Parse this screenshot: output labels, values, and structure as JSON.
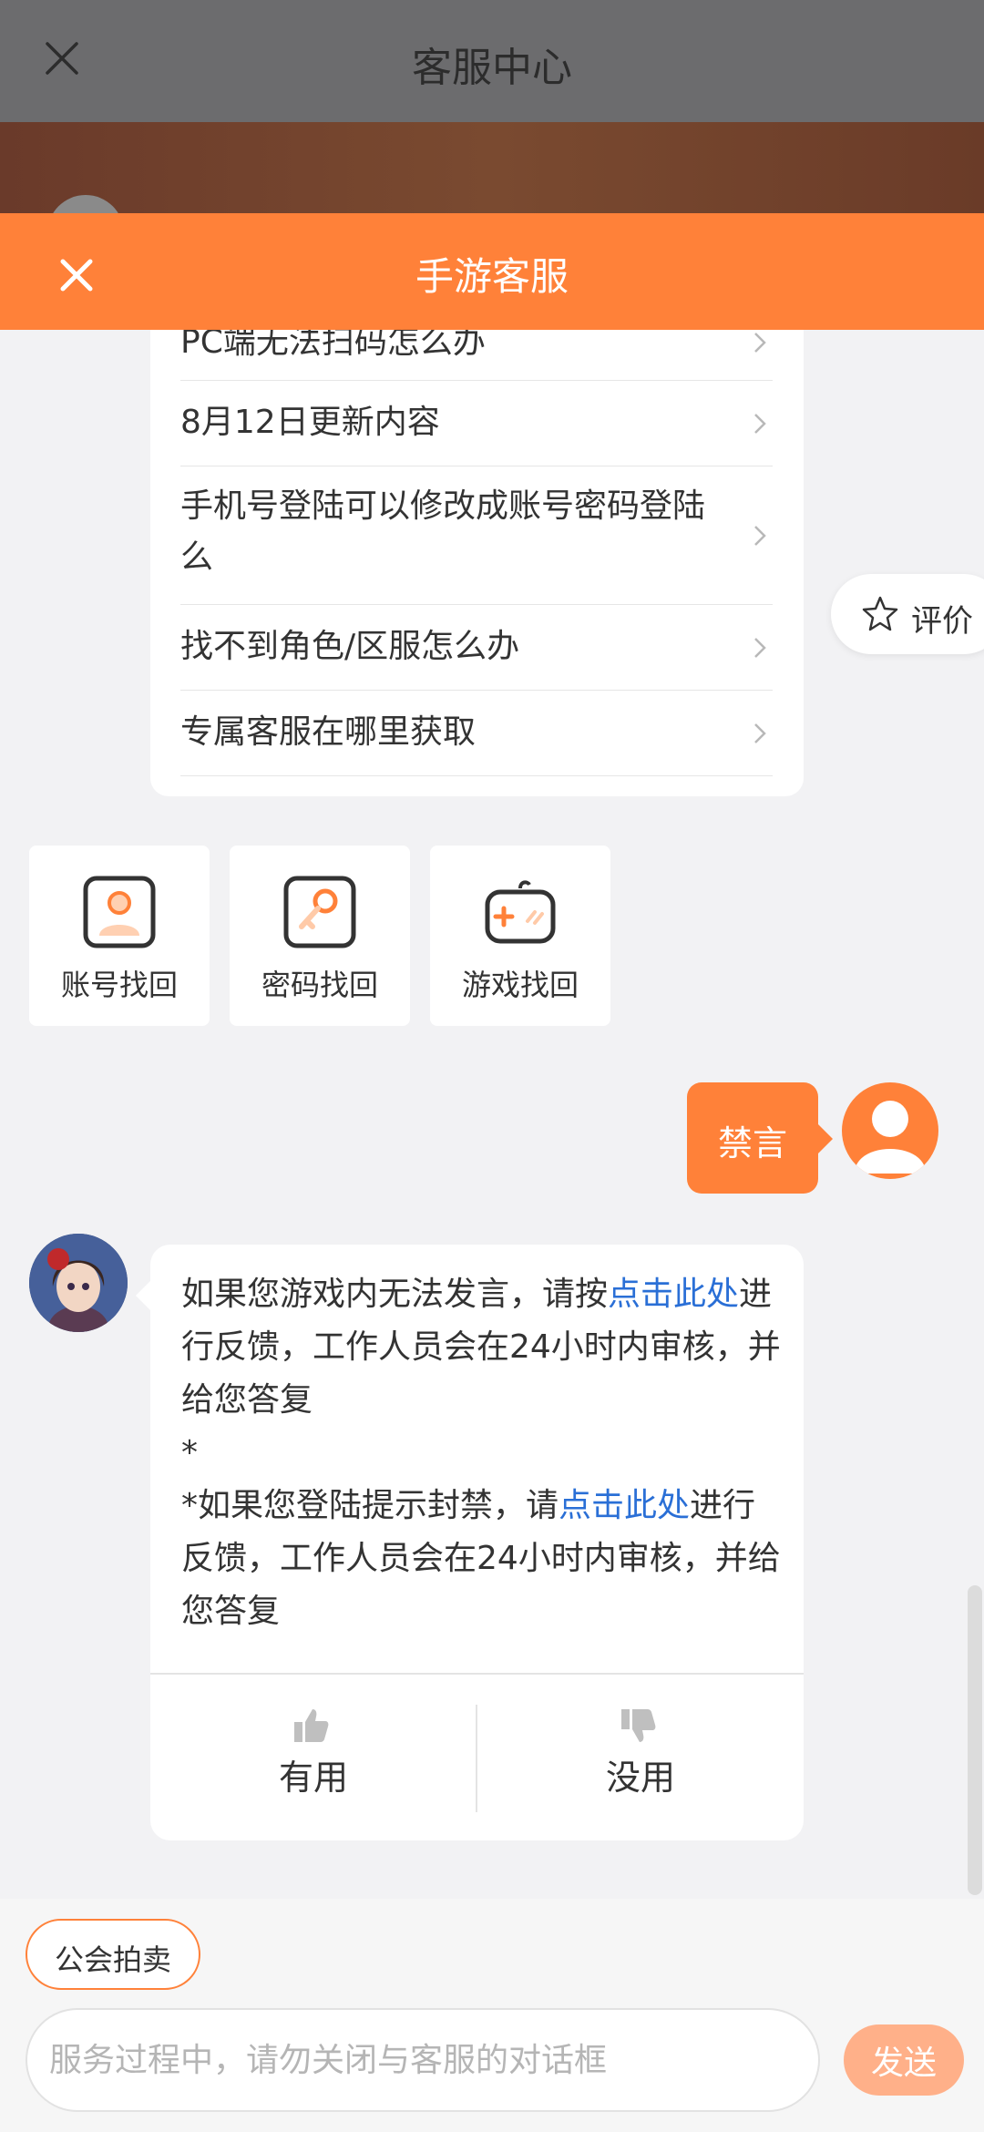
{
  "top_header": {
    "title": "客服中心"
  },
  "nav_bar": {
    "title": "手游客服",
    "bg_color": "#ff8139"
  },
  "faq": {
    "items": [
      {
        "label": "PC端无法扫码怎么办"
      },
      {
        "label": "8月12日更新内容"
      },
      {
        "label": "手机号登陆可以修改成账号密码登陆么"
      },
      {
        "label": "找不到角色/区服怎么办"
      },
      {
        "label": "专属客服在哪里获取"
      }
    ]
  },
  "review": {
    "label": "评价",
    "icon": "star-outline-icon"
  },
  "quick_tiles": [
    {
      "label": "账号找回",
      "icon": "account-recover-icon"
    },
    {
      "label": "密码找回",
      "icon": "password-key-icon"
    },
    {
      "label": "游戏找回",
      "icon": "gamepad-icon"
    }
  ],
  "user_message": {
    "text": "禁言"
  },
  "bot_message": {
    "p1_a": "如果您游戏内无法发言，请按",
    "p1_link": "点击此处",
    "p1_b": "进行反馈，工作人员会在24小时内审核，并给您答复",
    "star_line": "*",
    "p2_a": "*如果您登陆提示封禁，请",
    "p2_link": "点击此处",
    "p2_b": "进行反馈，工作人员会在24小时内审核，并给您答复",
    "link_color": "#2a6fd6"
  },
  "feedback": {
    "useful": "有用",
    "useless": "没用"
  },
  "bottom": {
    "tag": "公会拍卖",
    "input_placeholder": "服务过程中，请勿关闭与客服的对话框",
    "send": "发送"
  }
}
